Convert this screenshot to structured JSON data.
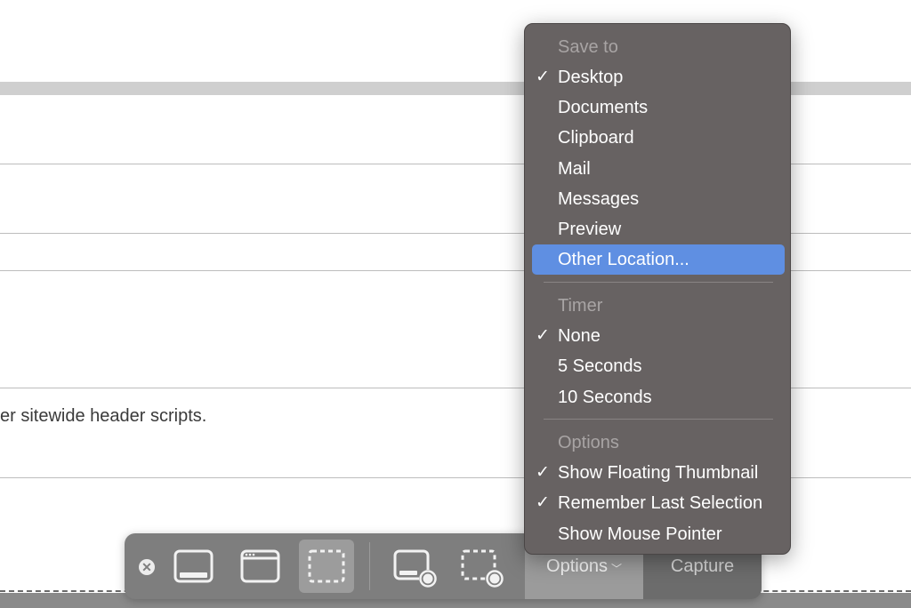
{
  "background": {
    "text_fragment": "er sitewide header scripts."
  },
  "toolbar": {
    "close_icon": "close-circle-icon",
    "capture_entire_screen": "capture-entire-screen-icon",
    "capture_window": "capture-window-icon",
    "capture_selection": "capture-selection-icon",
    "record_screen": "record-screen-icon",
    "record_selection": "record-selection-icon",
    "options_label": "Options",
    "capture_label": "Capture"
  },
  "menu": {
    "save_to_header": "Save to",
    "save_to": [
      {
        "label": "Desktop",
        "checked": true
      },
      {
        "label": "Documents",
        "checked": false
      },
      {
        "label": "Clipboard",
        "checked": false
      },
      {
        "label": "Mail",
        "checked": false
      },
      {
        "label": "Messages",
        "checked": false
      },
      {
        "label": "Preview",
        "checked": false
      },
      {
        "label": "Other Location...",
        "checked": false,
        "highlighted": true
      }
    ],
    "timer_header": "Timer",
    "timer": [
      {
        "label": "None",
        "checked": true
      },
      {
        "label": "5 Seconds",
        "checked": false
      },
      {
        "label": "10 Seconds",
        "checked": false
      }
    ],
    "options_header": "Options",
    "options": [
      {
        "label": "Show Floating Thumbnail",
        "checked": true
      },
      {
        "label": "Remember Last Selection",
        "checked": true
      },
      {
        "label": "Show Mouse Pointer",
        "checked": false
      }
    ],
    "check_glyph": "✓"
  },
  "colors": {
    "menu_bg": "#676262",
    "highlight": "#5f8fe2",
    "toolbar_bg": "#7e7e7e"
  }
}
